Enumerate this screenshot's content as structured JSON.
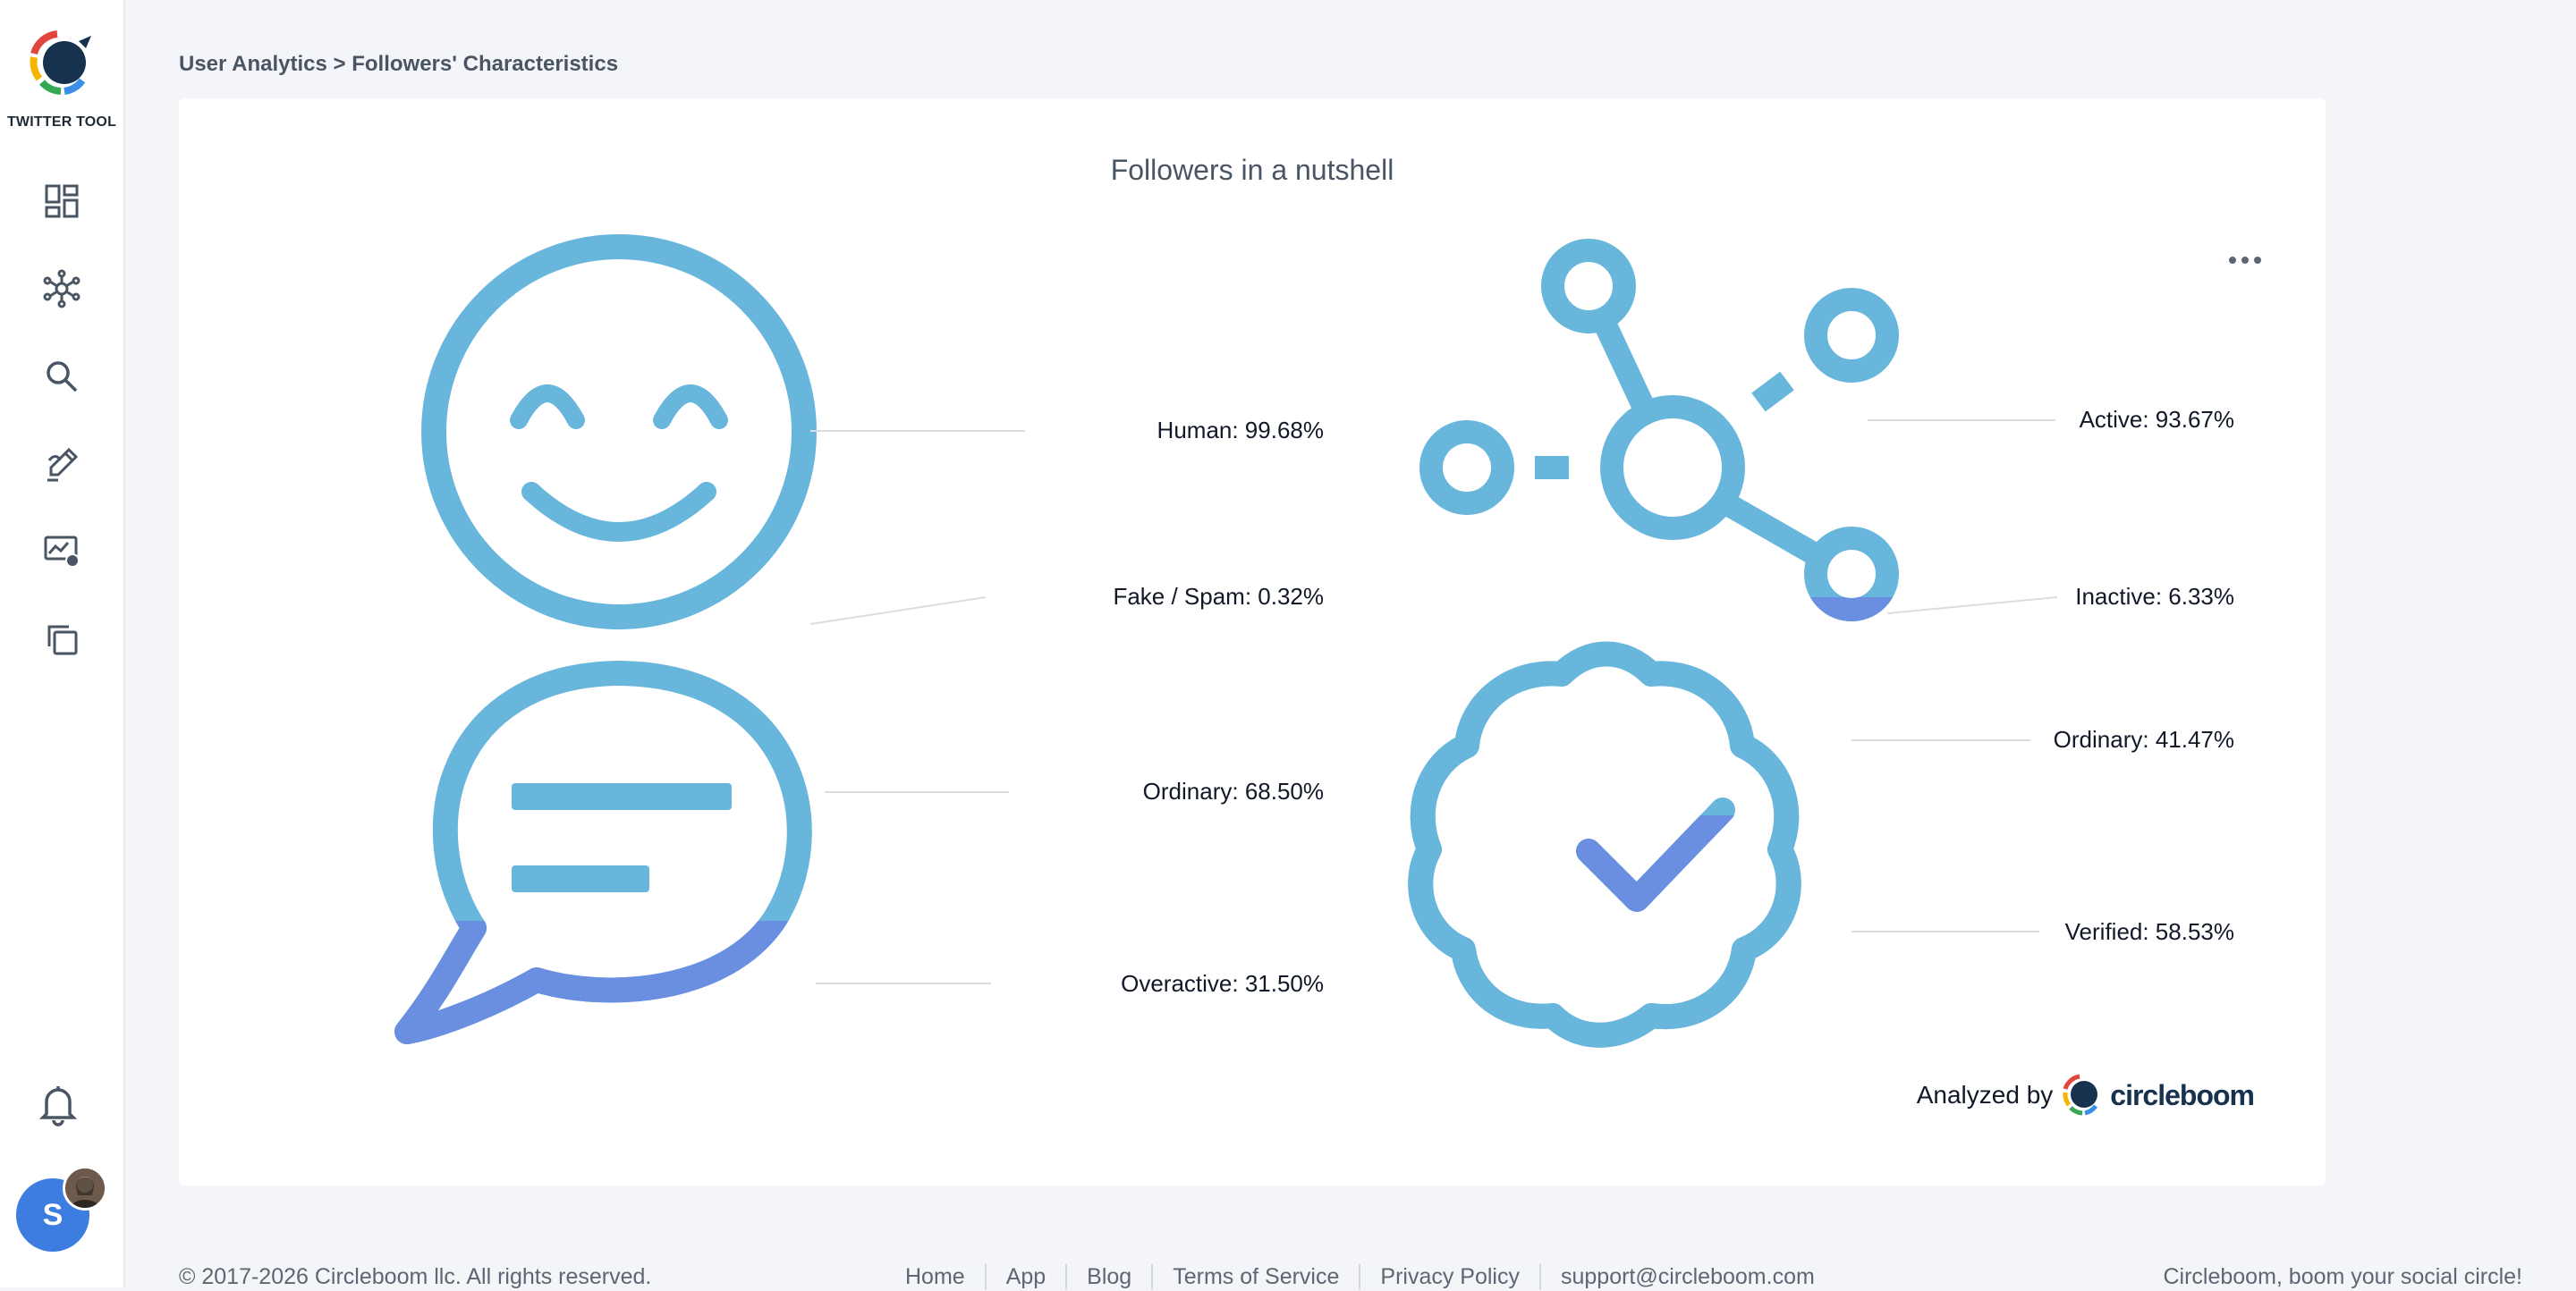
{
  "app": {
    "logo_text": "TWITTER TOOL"
  },
  "sidebar": {
    "icons": [
      "dashboard-icon",
      "network-icon",
      "search-icon",
      "compose-icon",
      "analytics-icon",
      "copy-icon"
    ],
    "bell": "bell-icon",
    "avatar_initial": "S"
  },
  "breadcrumb": {
    "parent": "User Analytics",
    "separator": ">",
    "current": "Followers' Characteristics"
  },
  "card": {
    "title": "Followers in a nutshell",
    "labels": {
      "human": "Human: 99.68%",
      "fake": "Fake / Spam: 0.32%",
      "ordinary_tweets": "Ordinary: 68.50%",
      "overactive": "Overactive: 31.50%",
      "active": "Active: 93.67%",
      "inactive": "Inactive: 6.33%",
      "ordinary_verified": "Ordinary: 41.47%",
      "verified": "Verified: 58.53%"
    },
    "values": {
      "human": 99.68,
      "fake": 0.32,
      "ordinary_tweets": 68.5,
      "overactive": 31.5,
      "active": 93.67,
      "inactive": 6.33,
      "ordinary_verified": 41.47,
      "verified": 58.53
    },
    "analyzed_by": "Analyzed by",
    "brand": "circleboom"
  },
  "colors": {
    "primary": "#68b6dc",
    "secondary": "#6b8fe0",
    "accent_text": "#16324f"
  },
  "footer": {
    "copyright": "© 2017-2026 Circleboom llc. All rights reserved.",
    "links": [
      "Home",
      "App",
      "Blog",
      "Terms of Service",
      "Privacy Policy",
      "support@circleboom.com"
    ],
    "tagline": "Circleboom, boom your social circle!"
  }
}
